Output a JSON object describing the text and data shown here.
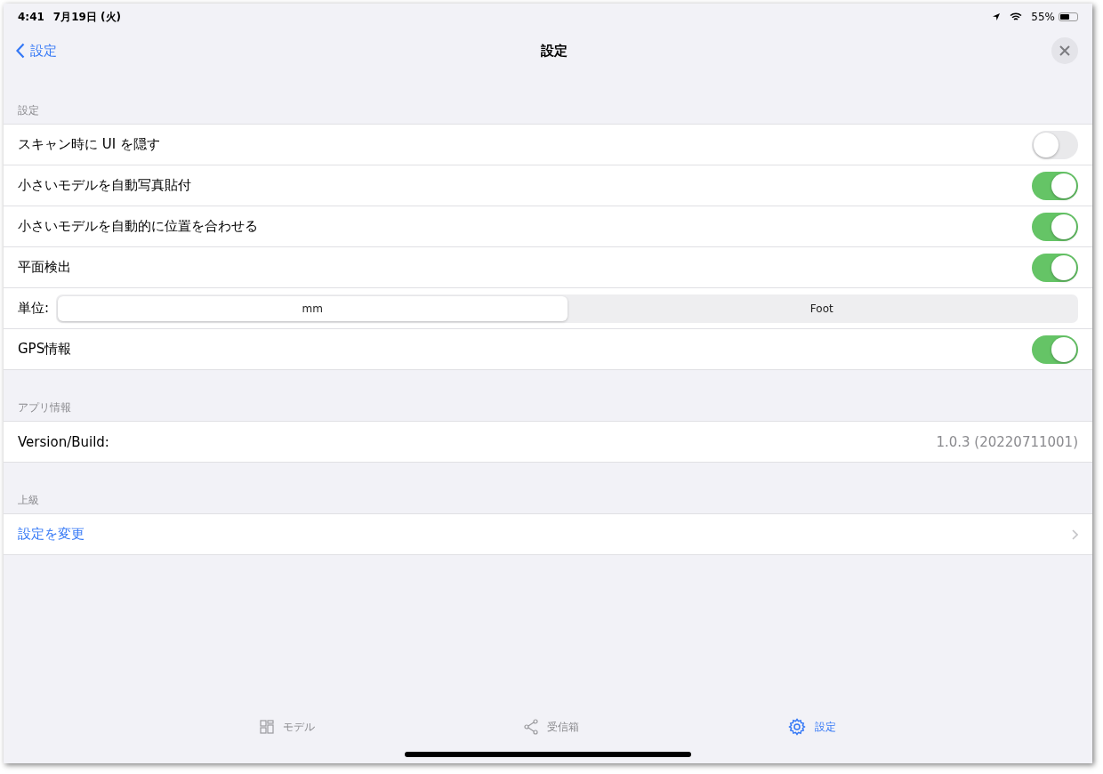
{
  "status_bar": {
    "time": "4:41",
    "date": "7月19日 (火)",
    "battery": "55%"
  },
  "nav": {
    "back_label": "設定",
    "title": "設定"
  },
  "sections": [
    {
      "header": "設定",
      "rows": [
        {
          "kind": "toggle",
          "label": "スキャン時に UI を隠す",
          "on": false
        },
        {
          "kind": "toggle",
          "label": "小さいモデルを自動写真貼付",
          "on": true
        },
        {
          "kind": "toggle",
          "label": "小さいモデルを自動的に位置を合わせる",
          "on": true
        },
        {
          "kind": "toggle",
          "label": "平面検出",
          "on": true
        },
        {
          "kind": "segmented",
          "label": "単位:",
          "segments": [
            {
              "label": "mm",
              "selected": true
            },
            {
              "label": "Foot",
              "selected": false
            }
          ]
        },
        {
          "kind": "toggle",
          "label": "GPS情報",
          "on": true
        }
      ]
    },
    {
      "header": "アプリ情報",
      "rows": [
        {
          "kind": "value",
          "label": "Version/Build:",
          "value": "1.0.3 (20220711001)"
        }
      ]
    },
    {
      "header": "上級",
      "rows": [
        {
          "kind": "link",
          "label": "設定を変更"
        }
      ]
    }
  ],
  "tabs": [
    {
      "label": "モデル",
      "kind": "grid",
      "selected": false
    },
    {
      "label": "受信箱",
      "kind": "share",
      "selected": false
    },
    {
      "label": "設定",
      "kind": "gear",
      "selected": true
    }
  ]
}
